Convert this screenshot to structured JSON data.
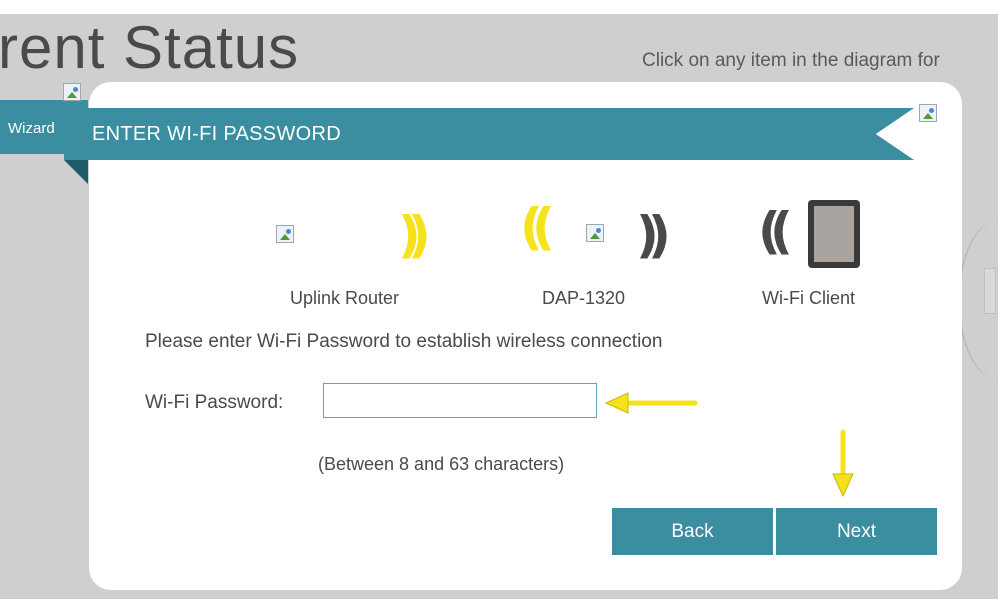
{
  "background": {
    "title": "rent Status",
    "hint": "Click on any item in the diagram for",
    "side_tab": "Wizard"
  },
  "dialog": {
    "title": "ENTER WI-FI PASSWORD",
    "devices": [
      {
        "label": "Uplink Router"
      },
      {
        "label": "DAP-1320"
      },
      {
        "label": "Wi-Fi Client"
      }
    ],
    "instruction": "Please enter Wi-Fi Password to establish wireless connection",
    "password_label": "Wi-Fi Password:",
    "password_value": "",
    "password_hint": "(Between 8 and 63 characters)",
    "back_label": "Back",
    "next_label": "Next"
  },
  "colors": {
    "accent": "#3a8ea0",
    "annotation_arrow": "#f5e21a",
    "wifi_wave_yellow": "#f5e21a",
    "wifi_wave_dark": "#4a4a4a"
  },
  "icons": [
    "broken-image-icon",
    "wifi-signal-icon",
    "tablet-icon"
  ]
}
